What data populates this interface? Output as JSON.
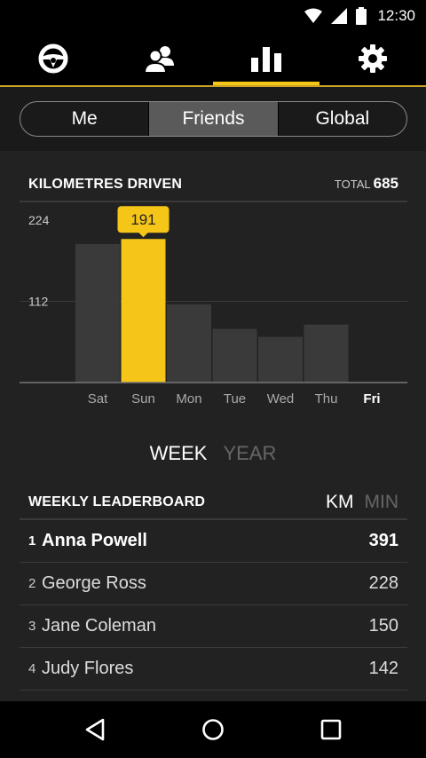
{
  "status_bar": {
    "time": "12:30",
    "icons": [
      "wifi-icon",
      "cell-signal-icon",
      "battery-icon"
    ]
  },
  "top_nav": {
    "tabs": [
      {
        "icon": "steering-wheel-icon",
        "active": false
      },
      {
        "icon": "friends-icon",
        "active": false
      },
      {
        "icon": "bar-chart-icon",
        "active": true
      },
      {
        "icon": "gear-icon",
        "active": false
      }
    ],
    "accent_color": "#f5c518"
  },
  "segmented": {
    "options": [
      "Me",
      "Friends",
      "Global"
    ],
    "selected": "Friends"
  },
  "km_section": {
    "title": "KILOMETRES DRIVEN",
    "total_label": "TOTAL",
    "total_value": "685"
  },
  "chart_data": {
    "type": "bar",
    "categories": [
      "Sat",
      "Sun",
      "Mon",
      "Tue",
      "Wed",
      "Thu",
      "Fri"
    ],
    "values": [
      191,
      198,
      108,
      74,
      63,
      80,
      0
    ],
    "highlighted_index": 1,
    "highlight_label": "191",
    "ylim": [
      0,
      224
    ],
    "yticks": [
      {
        "value": 224,
        "label": "224"
      },
      {
        "value": 112,
        "label": "112"
      }
    ],
    "bold_category": "Fri",
    "bar_color": "#3a3a3a",
    "highlight_color": "#f5c518"
  },
  "period": {
    "options": [
      "WEEK",
      "YEAR"
    ],
    "selected": "WEEK"
  },
  "leaderboard": {
    "title": "WEEKLY LEADERBOARD",
    "units": [
      "KM",
      "MIN"
    ],
    "selected_unit": "KM",
    "rows": [
      {
        "rank": "1",
        "name": "Anna Powell",
        "value": "391"
      },
      {
        "rank": "2",
        "name": "George Ross",
        "value": "228"
      },
      {
        "rank": "3",
        "name": "Jane Coleman",
        "value": "150"
      },
      {
        "rank": "4",
        "name": "Judy Flores",
        "value": "142"
      }
    ]
  },
  "bottom_nav": {
    "icons": [
      "back-icon",
      "home-icon",
      "recents-icon"
    ]
  }
}
